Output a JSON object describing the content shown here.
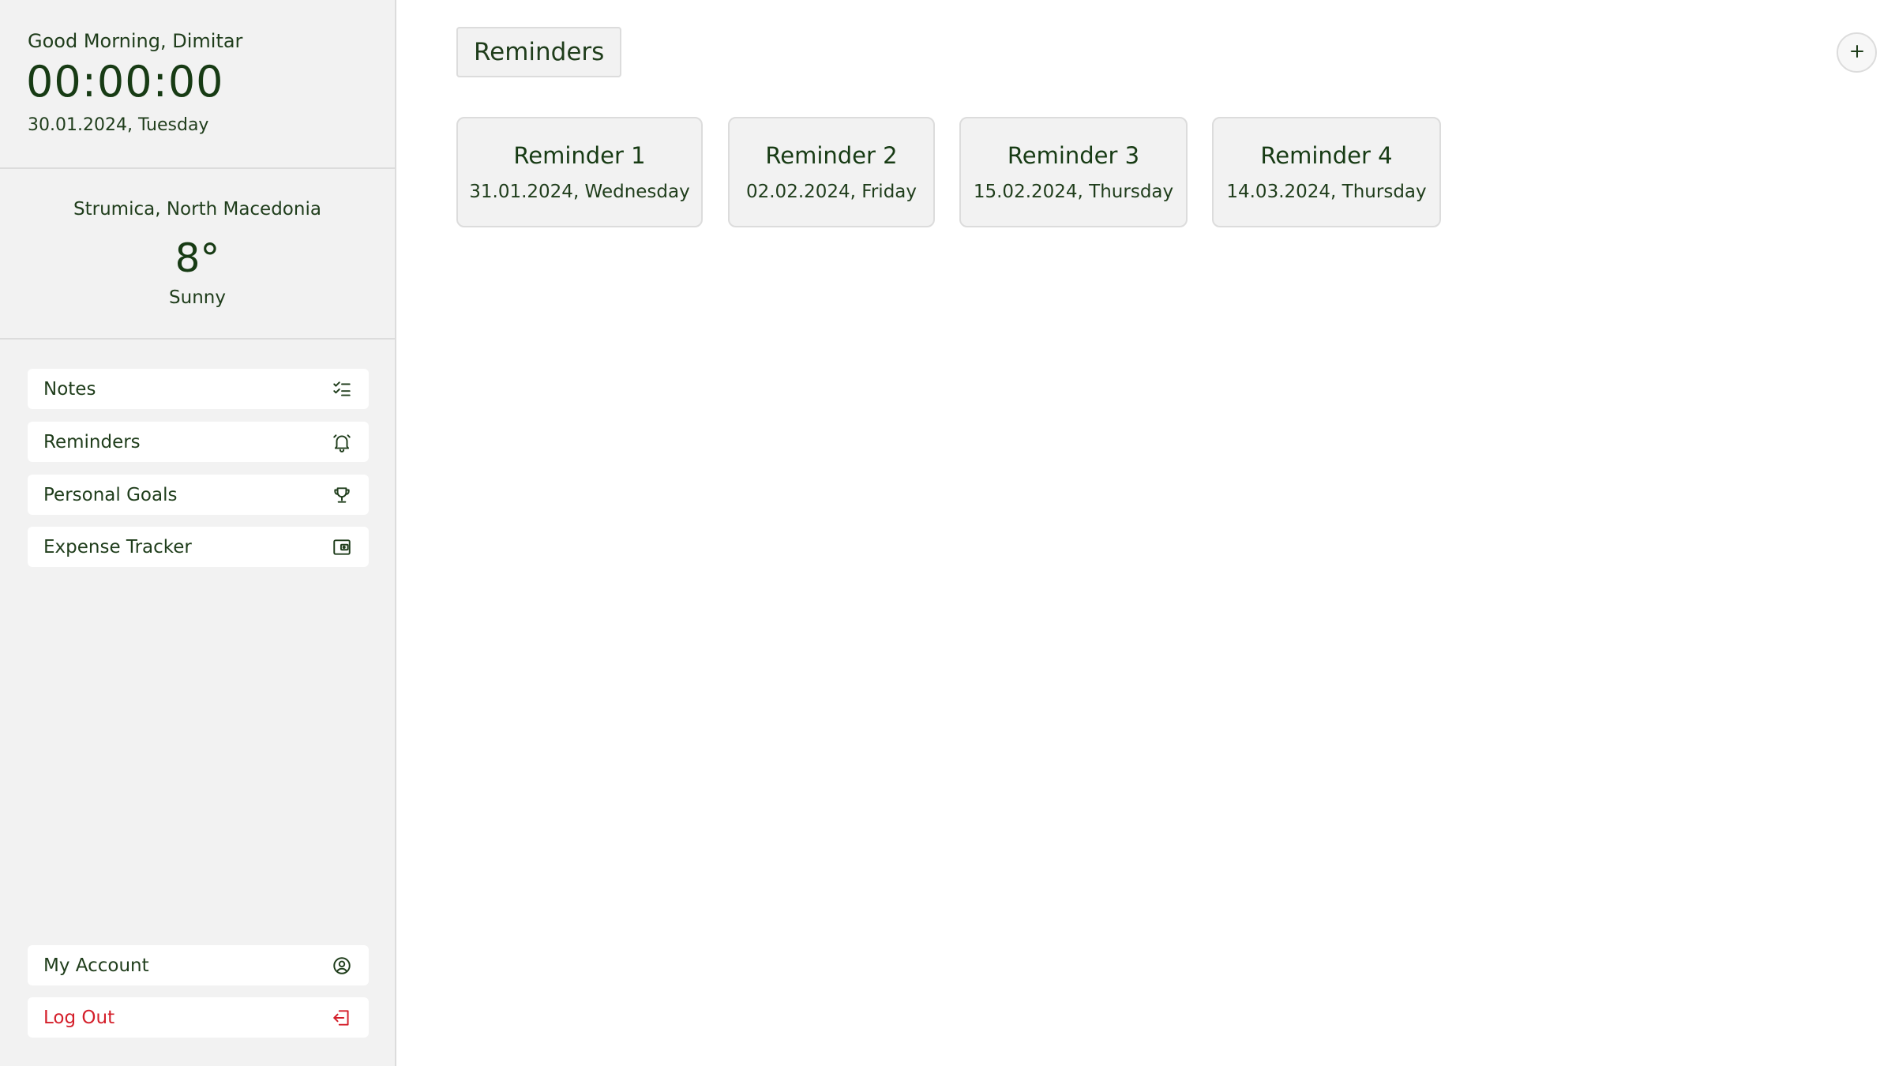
{
  "sidebar": {
    "greeting": "Good Morning, Dimitar",
    "clock": "00:00:00",
    "date": "30.01.2024, Tuesday",
    "weather": {
      "location": "Strumica, North Macedonia",
      "temperature": "8°",
      "condition": "Sunny"
    },
    "nav": [
      {
        "label": "Notes",
        "icon": "checklist-icon"
      },
      {
        "label": "Reminders",
        "icon": "bell-icon"
      },
      {
        "label": "Personal Goals",
        "icon": "trophy-icon"
      },
      {
        "label": "Expense Tracker",
        "icon": "wallet-icon"
      }
    ],
    "account": {
      "label": "My Account",
      "icon": "user-circle-icon"
    },
    "logout": {
      "label": "Log Out",
      "icon": "logout-icon"
    }
  },
  "main": {
    "title": "Reminders",
    "add_icon": "plus-icon",
    "reminders": [
      {
        "title": "Reminder 1",
        "date": "31.01.2024, Wednesday"
      },
      {
        "title": "Reminder 2",
        "date": "02.02.2024, Friday"
      },
      {
        "title": "Reminder 3",
        "date": "15.02.2024, Thursday"
      },
      {
        "title": "Reminder 4",
        "date": "14.03.2024, Thursday"
      }
    ]
  },
  "colors": {
    "accent": "#173b14",
    "text": "#1f3d1b",
    "sidebar_bg": "#f2f2f2",
    "border": "#dcdcdc",
    "logout": "#d41f2a"
  }
}
